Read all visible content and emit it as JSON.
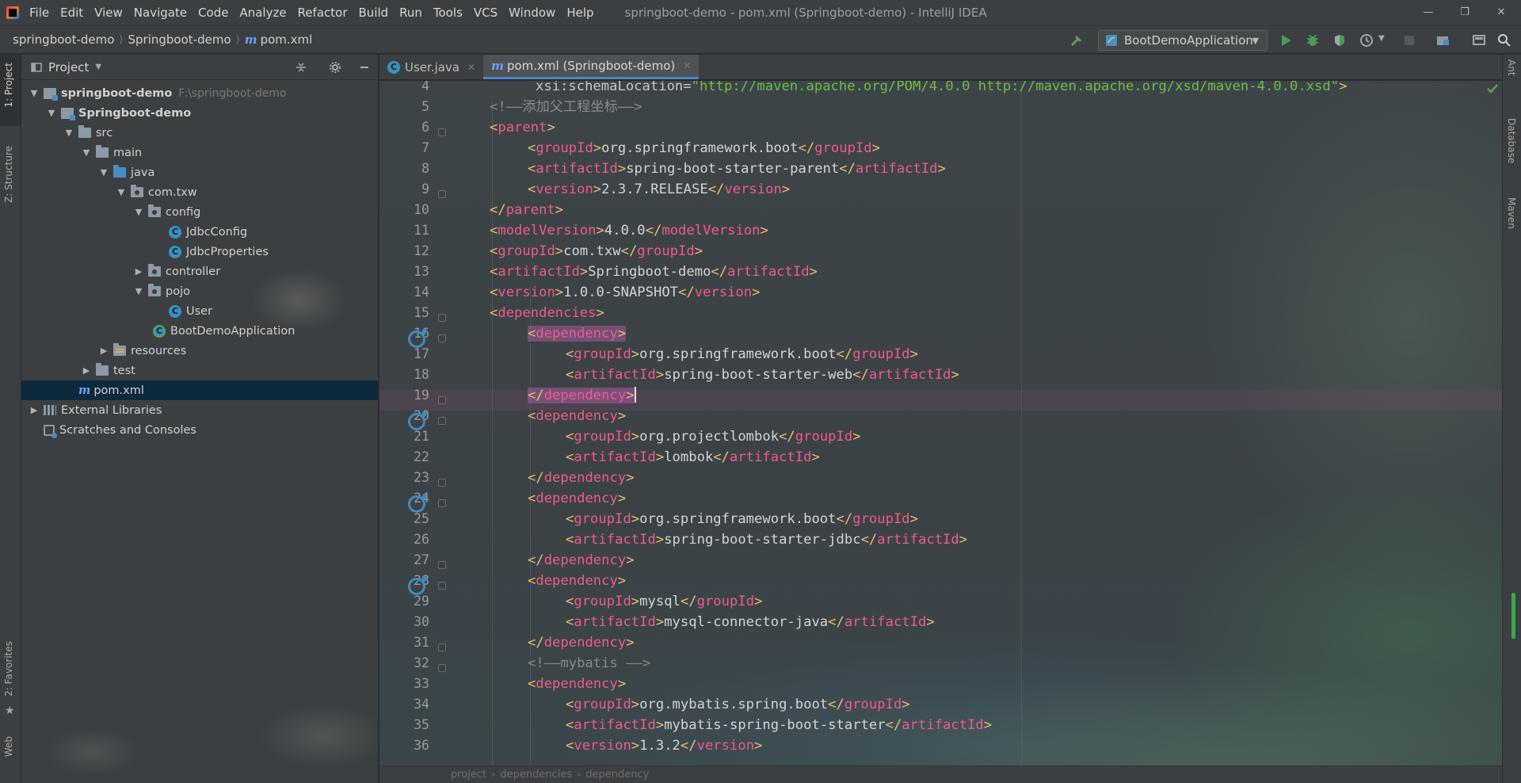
{
  "menu": [
    "File",
    "Edit",
    "View",
    "Navigate",
    "Code",
    "Analyze",
    "Refactor",
    "Build",
    "Run",
    "Tools",
    "VCS",
    "Window",
    "Help"
  ],
  "window_title": "springboot-demo - pom.xml (Springboot-demo) - IntelliJ IDEA",
  "breadcrumb": [
    "springboot-demo",
    "Springboot-demo",
    "pom.xml"
  ],
  "run_config": "BootDemoApplication",
  "left_strip": [
    "1: Project",
    "Z: Structure",
    "2: Favorites",
    "Web"
  ],
  "right_strip": [
    "Ant",
    "Database",
    "Maven"
  ],
  "project_panel": {
    "title": "Project",
    "tree": [
      {
        "label": "springboot-demo",
        "hint": "F:\\springboot-demo"
      },
      {
        "label": "Springboot-demo"
      },
      {
        "label": "src"
      },
      {
        "label": "main"
      },
      {
        "label": "java"
      },
      {
        "label": "com.txw"
      },
      {
        "label": "config"
      },
      {
        "label": "JdbcConfig"
      },
      {
        "label": "JdbcProperties"
      },
      {
        "label": "controller"
      },
      {
        "label": "pojo"
      },
      {
        "label": "User"
      },
      {
        "label": "BootDemoApplication"
      },
      {
        "label": "resources"
      },
      {
        "label": "test"
      },
      {
        "label": "pom.xml"
      },
      {
        "label": "External Libraries"
      },
      {
        "label": "Scratches and Consoles"
      }
    ]
  },
  "tabs": [
    {
      "label": "User.java",
      "active": false
    },
    {
      "label": "pom.xml (Springboot-demo)",
      "active": true
    }
  ],
  "editor": {
    "line_numbers": [
      "4",
      "5",
      "6",
      "7",
      "8",
      "9",
      "10",
      "11",
      "12",
      "13",
      "14",
      "15",
      "16",
      "17",
      "18",
      "19",
      "20",
      "21",
      "22",
      "23",
      "24",
      "25",
      "26",
      "27",
      "28",
      "29",
      "30",
      "31",
      "32",
      "33",
      "34",
      "35",
      "36"
    ],
    "code": {
      "l4_attr": "xsi:schemaLocation",
      "l4_value": "\"http://maven.apache.org/POM/4.0.0 http://maven.apache.org/xsd/maven-4.0.0.xsd\"",
      "l5_comment": "<!——添加父工程坐标——>",
      "l7_text": "org.springframework.boot",
      "l8_text": "spring-boot-starter-parent",
      "l9_text": "2.3.7.RELEASE",
      "l11_text": "4.0.0",
      "l12_text": "com.txw",
      "l13_text": "Springboot-demo",
      "l14_text": "1.0.0-SNAPSHOT",
      "l17_text": "org.springframework.boot",
      "l18_text": "spring-boot-starter-web",
      "l21_text": "org.projectlombok",
      "l22_text": "lombok",
      "l25_text": "org.springframework.boot",
      "l26_text": "spring-boot-starter-jdbc",
      "l29_text": "mysql",
      "l30_text": "mysql-connector-java",
      "l32_comment": "<!——mybatis ——>",
      "l34_text": "org.mybatis.spring.boot",
      "l35_text": "mybatis-spring-boot-starter",
      "l36_text": "1.3.2"
    },
    "tags": {
      "parent": "parent",
      "groupId": "groupId",
      "artifactId": "artifactId",
      "version": "version",
      "modelVersion": "modelVersion",
      "dependencies": "dependencies",
      "dependency": "dependency"
    }
  },
  "editor_breadcrumb": [
    "project",
    "dependencies",
    "dependency"
  ],
  "colors": {
    "accent": "#4a88c7",
    "tag_name": "#f05a8a",
    "string": "#6abf45",
    "selection": "#0d293e"
  }
}
